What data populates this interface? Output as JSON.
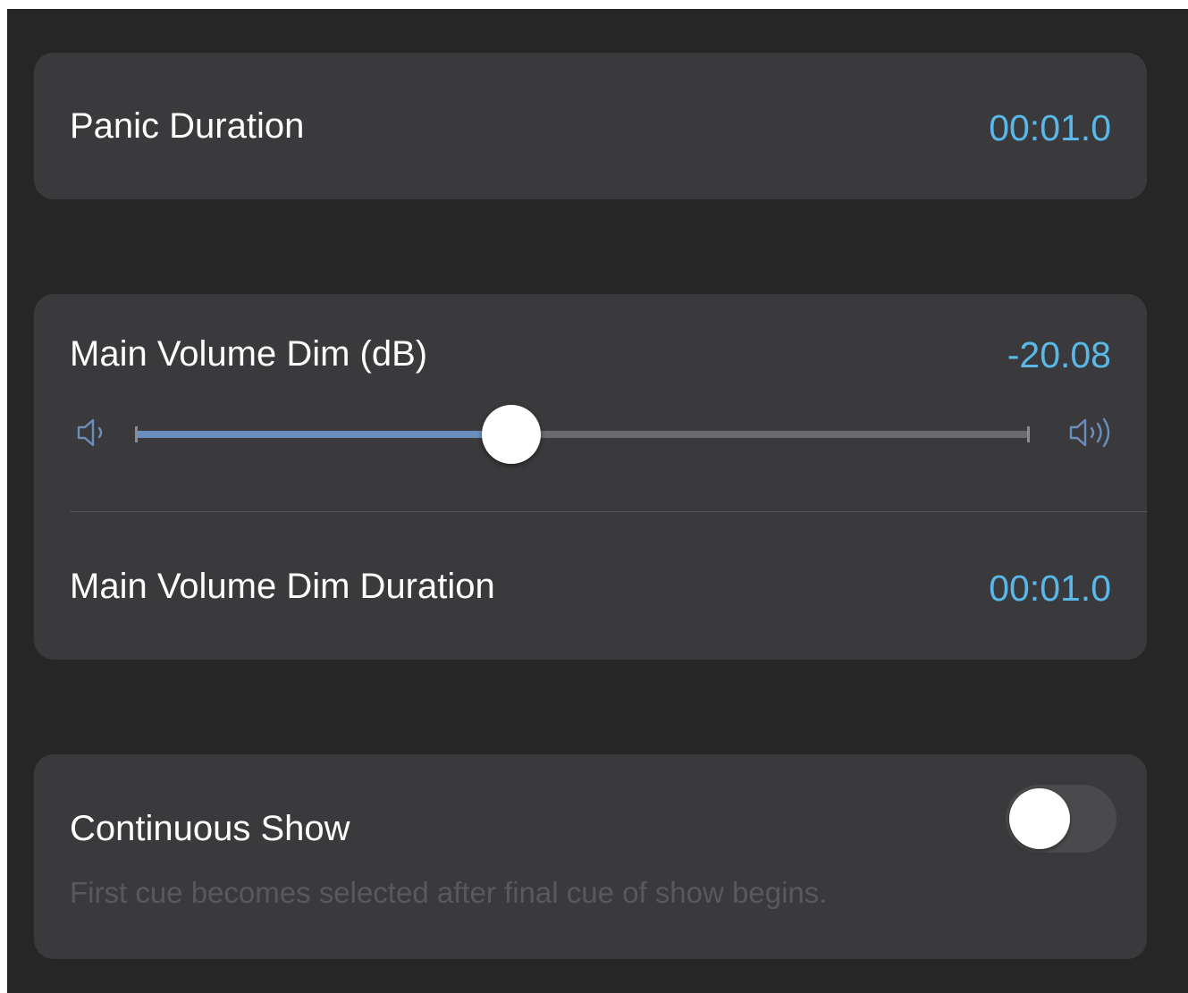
{
  "panic_duration": {
    "label": "Panic Duration",
    "value": "00:01.0"
  },
  "main_volume_dim": {
    "label": "Main Volume Dim (dB)",
    "value": "-20.08",
    "slider_fraction": 0.42,
    "min_icon": "speaker-low-icon",
    "max_icon": "speaker-high-icon"
  },
  "main_volume_dim_duration": {
    "label": "Main Volume Dim Duration",
    "value": "00:01.0"
  },
  "continuous_show": {
    "label": "Continuous Show",
    "enabled": false,
    "description": "First cue becomes selected after final cue of show begins."
  },
  "colors": {
    "background": "#262626",
    "card": "#3a3a3c",
    "accent_value": "#5ab8e9",
    "slider_fill": "#6a8fbd",
    "slider_track": "#6b6b6d"
  }
}
